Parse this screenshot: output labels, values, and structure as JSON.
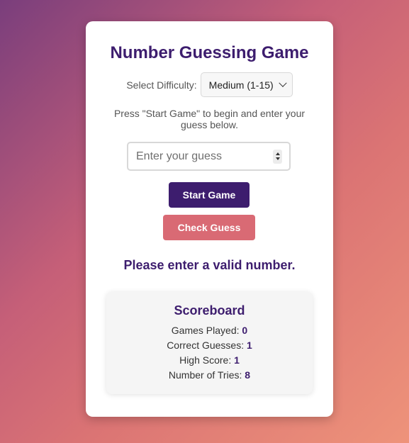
{
  "colors": {
    "primary": "#3d1d6e",
    "accent": "#d96a74",
    "card_bg": "#ffffff",
    "scoreboard_bg": "#f5f5f5"
  },
  "game": {
    "title": "Number Guessing Game",
    "difficulty_label": "Select Difficulty:",
    "difficulty_selected": "Medium (1-15)",
    "instructions": "Press \"Start Game\" to begin and enter your guess below.",
    "guess_placeholder": "Enter your guess",
    "start_button_label": "Start Game",
    "check_button_label": "Check Guess",
    "message": "Please enter a valid number."
  },
  "scoreboard": {
    "title": "Scoreboard",
    "games_played_label": "Games Played:",
    "games_played_value": "0",
    "correct_guesses_label": "Correct Guesses:",
    "correct_guesses_value": "1",
    "high_score_label": "High Score:",
    "high_score_value": "1",
    "tries_label": "Number of Tries:",
    "tries_value": "8"
  }
}
